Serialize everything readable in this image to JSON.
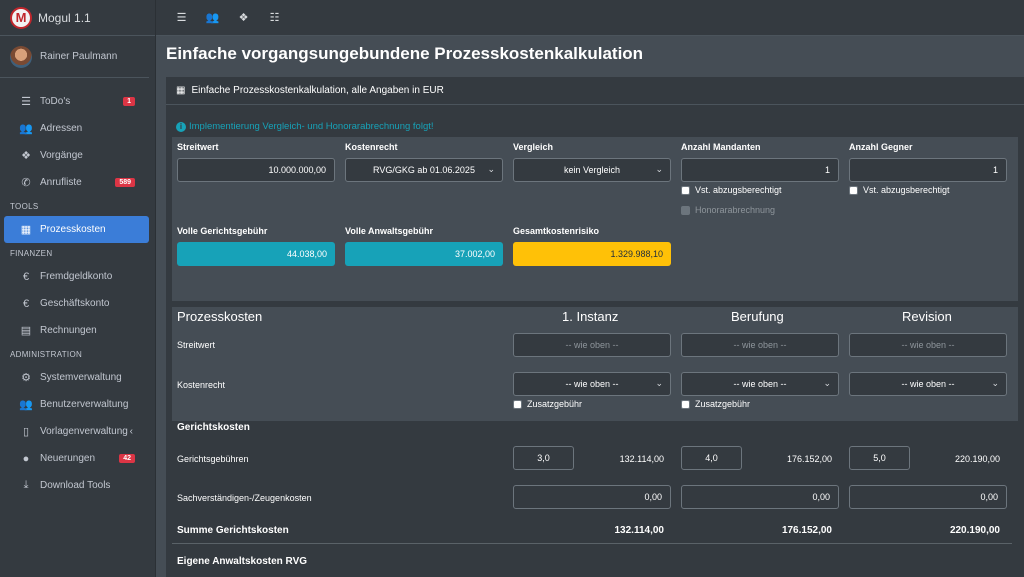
{
  "app": {
    "title": "Mogul 1.1",
    "logo_letter": "M"
  },
  "user": {
    "name": "Rainer Paulmann"
  },
  "sidebar": {
    "items": [
      {
        "label": "ToDo's",
        "icon": "list-icon",
        "badge": "1"
      },
      {
        "label": "Adressen",
        "icon": "users-icon"
      },
      {
        "label": "Vorgänge",
        "icon": "cubes-icon"
      },
      {
        "label": "Anrufliste",
        "icon": "phone-icon",
        "badge": "589"
      }
    ],
    "section_tools": "TOOLS",
    "tools_items": [
      {
        "label": "Prozesskosten",
        "icon": "calculator-icon",
        "active": true
      }
    ],
    "section_finanzen": "FINANZEN",
    "finanzen_items": [
      {
        "label": "Fremdgeldkonto",
        "icon": "euro-icon"
      },
      {
        "label": "Geschäftskonto",
        "icon": "euro-icon"
      },
      {
        "label": "Rechnungen",
        "icon": "file-icon"
      }
    ],
    "section_admin": "ADMINISTRATION",
    "admin_items": [
      {
        "label": "Systemverwaltung",
        "icon": "cogs-icon"
      },
      {
        "label": "Benutzerverwaltung",
        "icon": "users-cog-icon"
      },
      {
        "label": "Vorlagenverwaltung",
        "icon": "file-alt-icon"
      },
      {
        "label": "Neuerungen",
        "icon": "lightbulb-icon",
        "badge": "42"
      },
      {
        "label": "Download Tools",
        "icon": "download-icon"
      }
    ]
  },
  "page": {
    "title": "Einfache vorgangsungebundene Prozesskostenkalkulation",
    "card_title": "Einfache Prozesskostenkalkulation, alle Angaben in EUR",
    "info": "Implementierung Vergleich- und Honorarabrechnung folgt!"
  },
  "form": {
    "streitwert_label": "Streitwert",
    "streitwert_value": "10.000.000,00",
    "kostenrecht_label": "Kostenrecht",
    "kostenrecht_value": "RVG/GKG ab 01.06.2025",
    "vergleich_label": "Vergleich",
    "vergleich_value": "kein Vergleich",
    "mandanten_label": "Anzahl Mandanten",
    "mandanten_value": "1",
    "gegner_label": "Anzahl Gegner",
    "gegner_value": "1",
    "vst_label": "Vst. abzugsberechtigt",
    "honorar_label": "Honorarabrechnung",
    "gerichtsgebuehr_label": "Volle Gerichtsgebühr",
    "gerichtsgebuehr_value": "44.038,00",
    "anwaltsgebuehr_label": "Volle Anwaltsgebühr",
    "anwaltsgebuehr_value": "37.002,00",
    "gesamt_label": "Gesamtkostenrisiko",
    "gesamt_value": "1.329.988,10"
  },
  "table": {
    "title": "Prozesskosten",
    "columns": [
      "1. Instanz",
      "Berufung",
      "Revision"
    ],
    "streitwert_label": "Streitwert",
    "placeholder": "-- wie oben --",
    "kostenrecht_label": "Kostenrecht",
    "select_value": "-- wie oben --",
    "zusatz_label": "Zusatzgebühr",
    "gerichtskosten_title": "Gerichtskosten",
    "gerichtsgebuehren_label": "Gerichtsgebühren",
    "factors": [
      "3,0",
      "4,0",
      "5,0"
    ],
    "gebuehren": [
      "132.114,00",
      "176.152,00",
      "220.190,00"
    ],
    "sachverst_label": "Sachverständigen-/Zeugenkosten",
    "sachverst_values": [
      "0,00",
      "0,00",
      "0,00"
    ],
    "summe_label": "Summe Gerichtskosten",
    "summe_values": [
      "132.114,00",
      "176.152,00",
      "220.190,00"
    ],
    "anwalt_title": "Eigene Anwaltskosten RVG"
  },
  "topbar": {
    "icons": [
      "bars-icon",
      "users-icon",
      "cubes-icon",
      "list-ol-icon"
    ]
  }
}
